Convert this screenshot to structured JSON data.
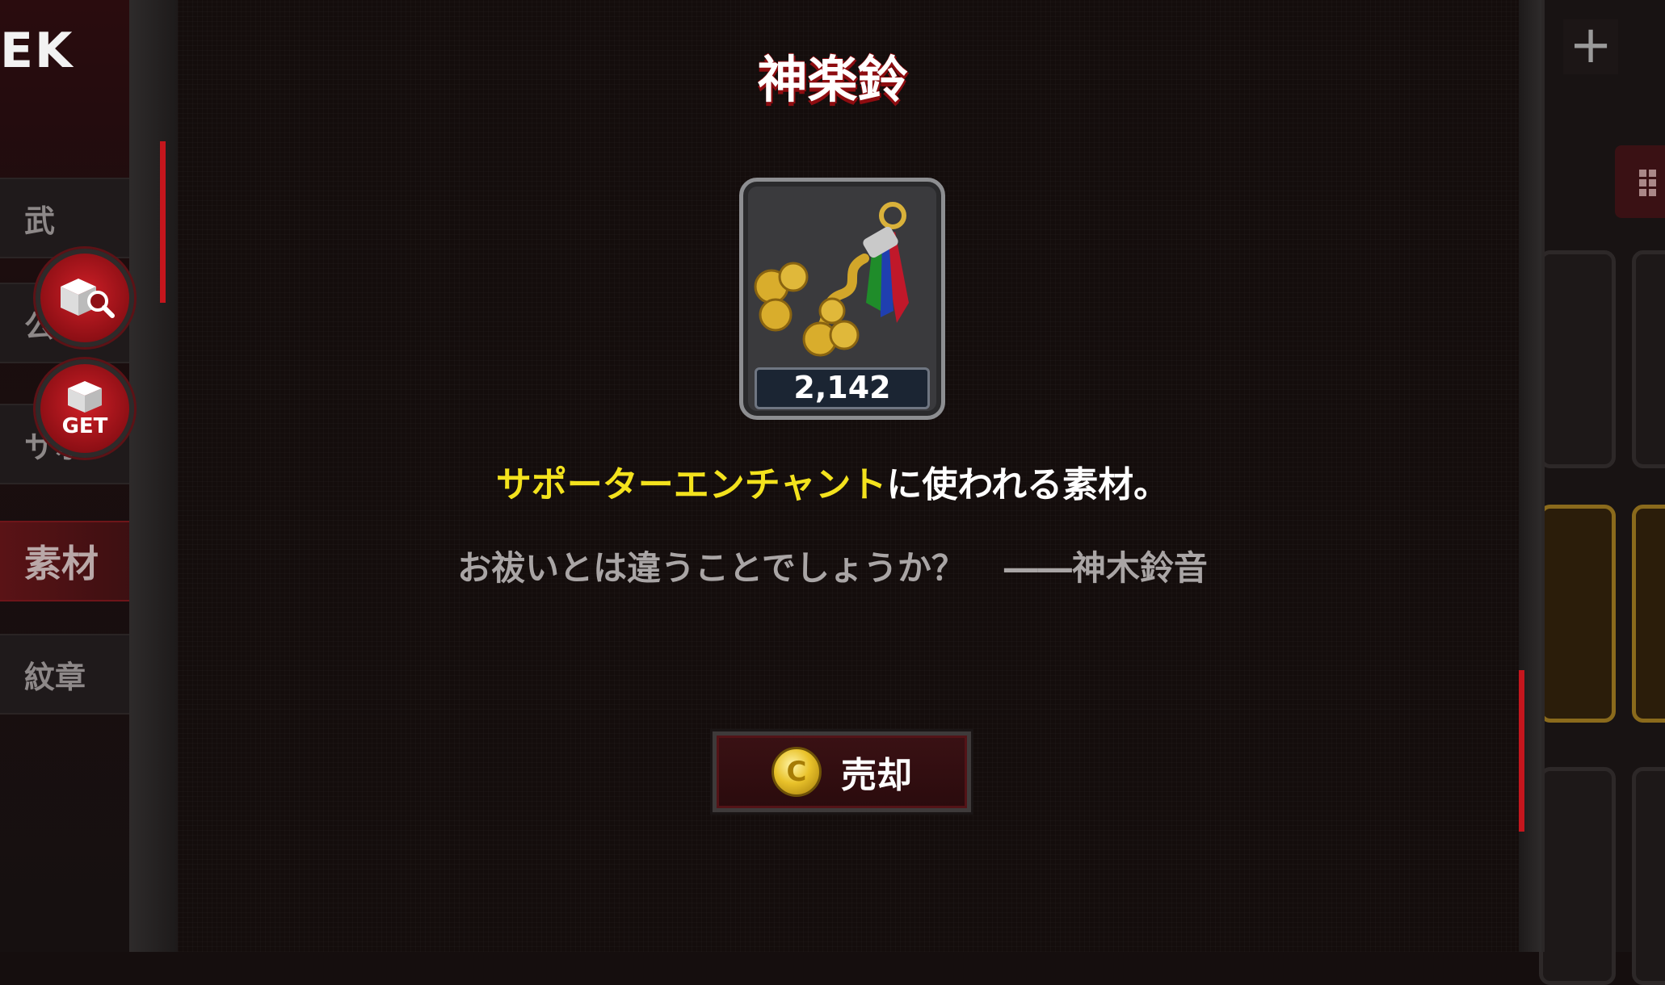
{
  "background": {
    "corner_text": "EK",
    "tabs": [
      "武",
      "公",
      "サポ-",
      "素材",
      "紋章"
    ],
    "active_tab": "素材",
    "round_buttons": [
      {
        "name": "item-search",
        "icon": "box-magnifier-icon"
      },
      {
        "name": "get",
        "icon": "box-icon",
        "label": "GET"
      }
    ]
  },
  "modal": {
    "title": "神楽鈴",
    "item": {
      "icon": "kagura-bell-icon",
      "count": "2,142"
    },
    "description": {
      "highlight": "サポーターエンチャント",
      "rest": "に使われる素材。"
    },
    "flavor": {
      "quote": "お祓いとは違うことでしょうか？",
      "attribution": "――神木鈴音"
    },
    "sell_button": {
      "label": "売却",
      "coin_icon": "coin-icon",
      "coin_glyph": "C"
    }
  },
  "colors": {
    "accent_red": "#c4161d",
    "highlight_yellow": "#f3e21d",
    "background": "#140d0c"
  }
}
